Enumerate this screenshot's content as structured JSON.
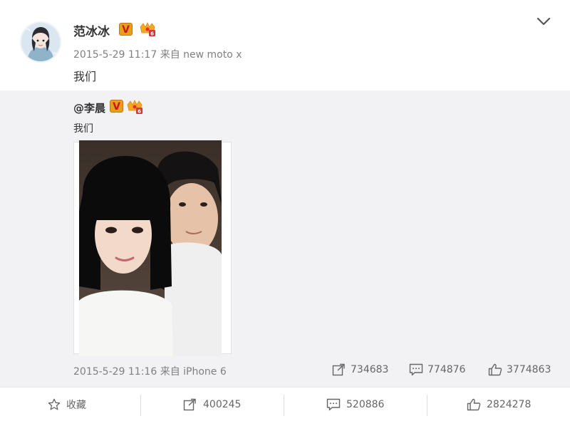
{
  "post": {
    "username": "范冰冰",
    "verified_badge": "V",
    "meta": "2015-5-29 11:17 来自 new moto x",
    "text": "我们"
  },
  "repost": {
    "original_user": "@李晨",
    "verified_badge": "V",
    "text": "我们",
    "meta": "2015-5-29 11:16 来自 iPhone 6",
    "repost_count": "734683",
    "comment_count": "774876",
    "like_count": "3774863"
  },
  "actions": {
    "favorite_label": "收藏",
    "repost_count": "400245",
    "comment_count": "520886",
    "like_count": "2824278"
  },
  "colors": {
    "text_primary": "#333333",
    "text_meta": "#808080",
    "repost_bg": "#f2f2f5",
    "badge_gold": "#e8a01a",
    "badge_red": "#c9151e"
  },
  "icons": {
    "menu": "chevron-down-icon",
    "repost": "repost-icon",
    "comment": "comment-icon",
    "like": "thumbs-up-icon",
    "favorite": "star-icon",
    "vip": "vip-crown-icon"
  }
}
